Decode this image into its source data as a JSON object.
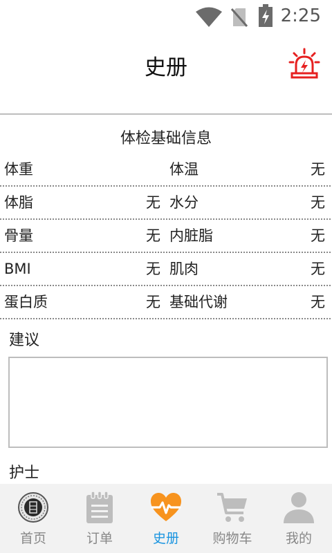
{
  "status_bar": {
    "time": "2:25",
    "icons": [
      "wifi-icon",
      "no-sim-icon",
      "battery-charging-icon"
    ]
  },
  "header": {
    "title": "史册",
    "alarm_icon": "alarm-light-icon",
    "alarm_color": "#e62020"
  },
  "checkup": {
    "title": "体检基础信息",
    "rows": [
      {
        "left_label": "体重",
        "left_value": "",
        "right_label": "体温",
        "right_value": "无"
      },
      {
        "left_label": "体脂",
        "left_value": "无",
        "right_label": "水分",
        "right_value": "无"
      },
      {
        "left_label": "骨量",
        "left_value": "无",
        "right_label": "内脏脂",
        "right_value": "无"
      },
      {
        "left_label": "BMI",
        "left_value": "无",
        "right_label": "肌肉",
        "right_value": "无"
      },
      {
        "left_label": "蛋白质",
        "left_value": "无",
        "right_label": "基础代谢",
        "right_value": "无"
      }
    ]
  },
  "advice": {
    "label": "建议",
    "value": ""
  },
  "nurse": {
    "label": "护士"
  },
  "nav": {
    "active_color": "#1b95e0",
    "active_icon_color": "#f7931e",
    "items": [
      {
        "label": "首页",
        "icon": "home-seal-icon"
      },
      {
        "label": "订单",
        "icon": "clipboard-icon"
      },
      {
        "label": "史册",
        "icon": "heart-pulse-icon",
        "active": true
      },
      {
        "label": "购物车",
        "icon": "cart-icon"
      },
      {
        "label": "我的",
        "icon": "user-icon"
      }
    ]
  }
}
